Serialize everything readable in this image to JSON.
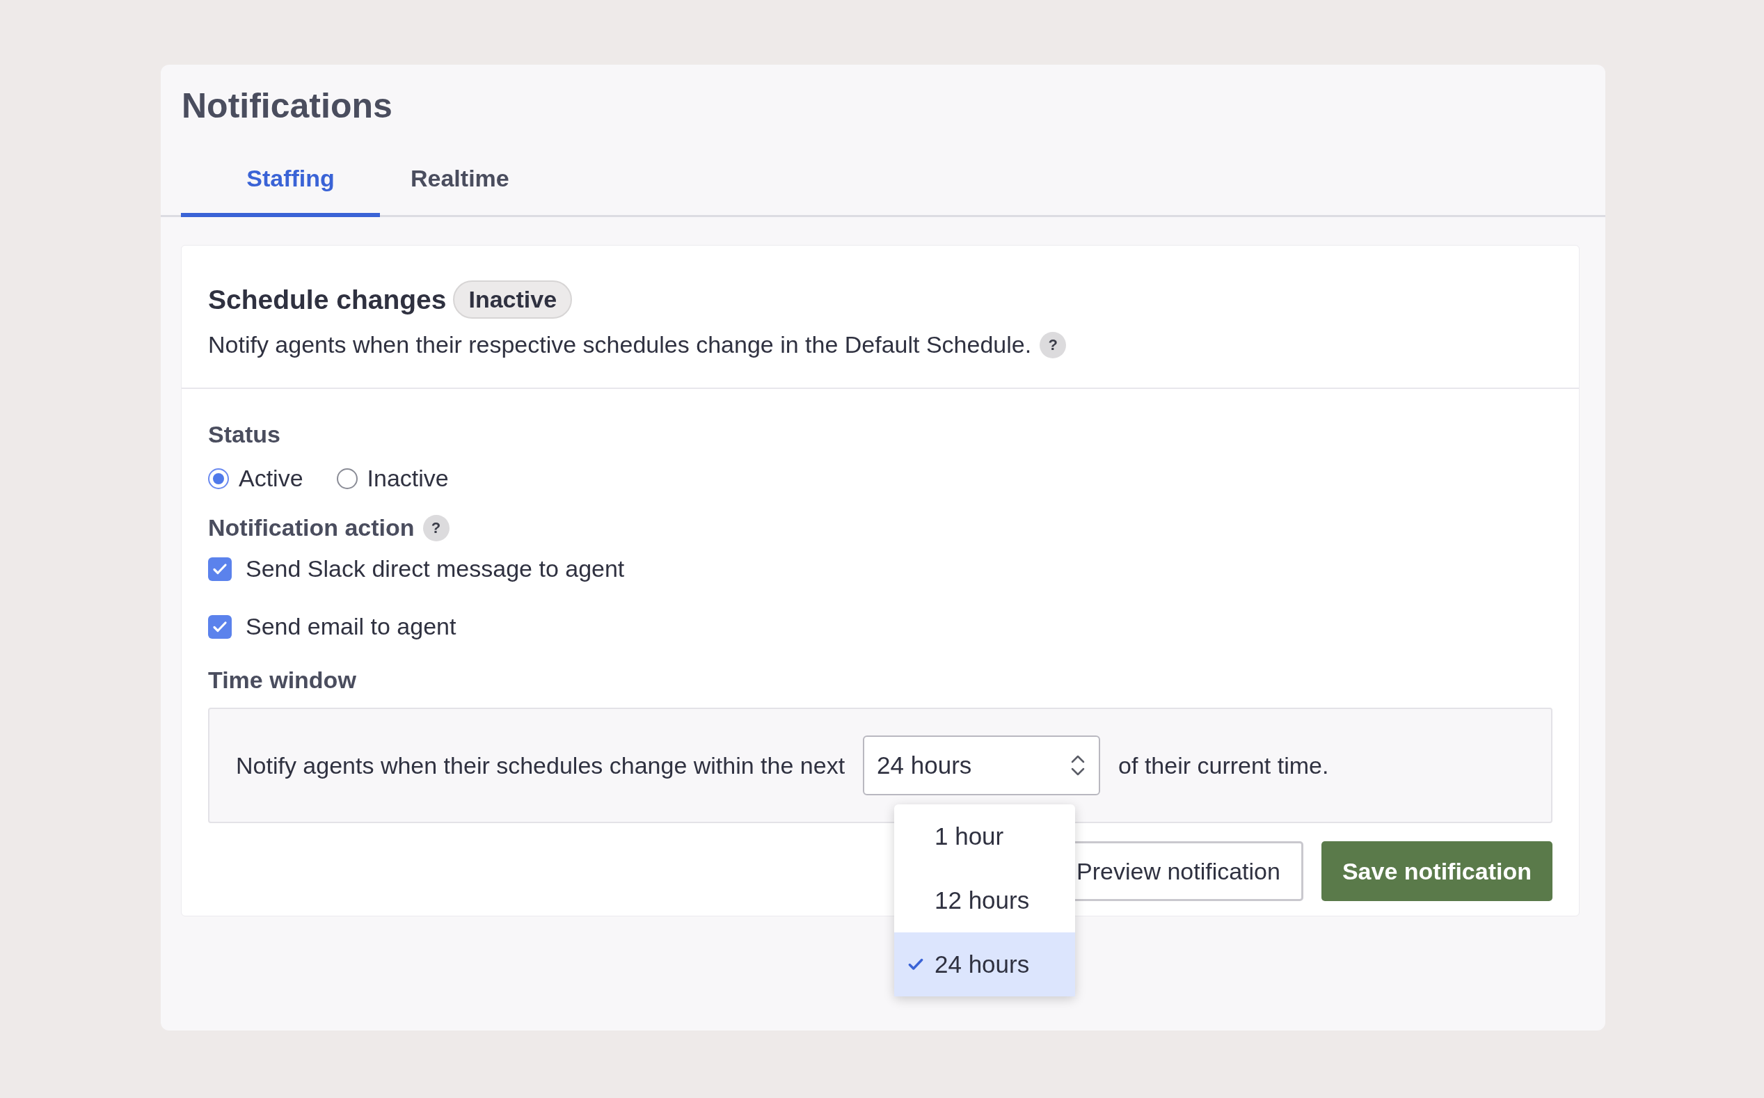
{
  "page": {
    "title": "Notifications"
  },
  "tabs": [
    {
      "label": "Staffing",
      "selected": true
    },
    {
      "label": "Realtime",
      "selected": false
    }
  ],
  "card": {
    "title": "Schedule changes",
    "badge": "Inactive",
    "description": "Notify agents when their respective schedules change in the Default Schedule.",
    "help": "?"
  },
  "status": {
    "label": "Status",
    "options": [
      {
        "label": "Active",
        "selected": true
      },
      {
        "label": "Inactive",
        "selected": false
      }
    ]
  },
  "notification_action": {
    "label": "Notification action",
    "help": "?",
    "options": [
      {
        "label": "Send Slack direct message to agent",
        "checked": true
      },
      {
        "label": "Send email to agent",
        "checked": true
      }
    ]
  },
  "time_window": {
    "label": "Time window",
    "text_before": "Notify agents when their schedules change within the next",
    "select_value": "24 hours",
    "text_after": "of their current time.",
    "expanded": true,
    "options": [
      {
        "label": "1 hour",
        "selected": false
      },
      {
        "label": "12 hours",
        "selected": false
      },
      {
        "label": "24 hours",
        "selected": true
      }
    ]
  },
  "buttons": [
    {
      "label": "Preview notification",
      "kind": "secondary"
    },
    {
      "label": "Save notification",
      "kind": "primary"
    }
  ]
}
